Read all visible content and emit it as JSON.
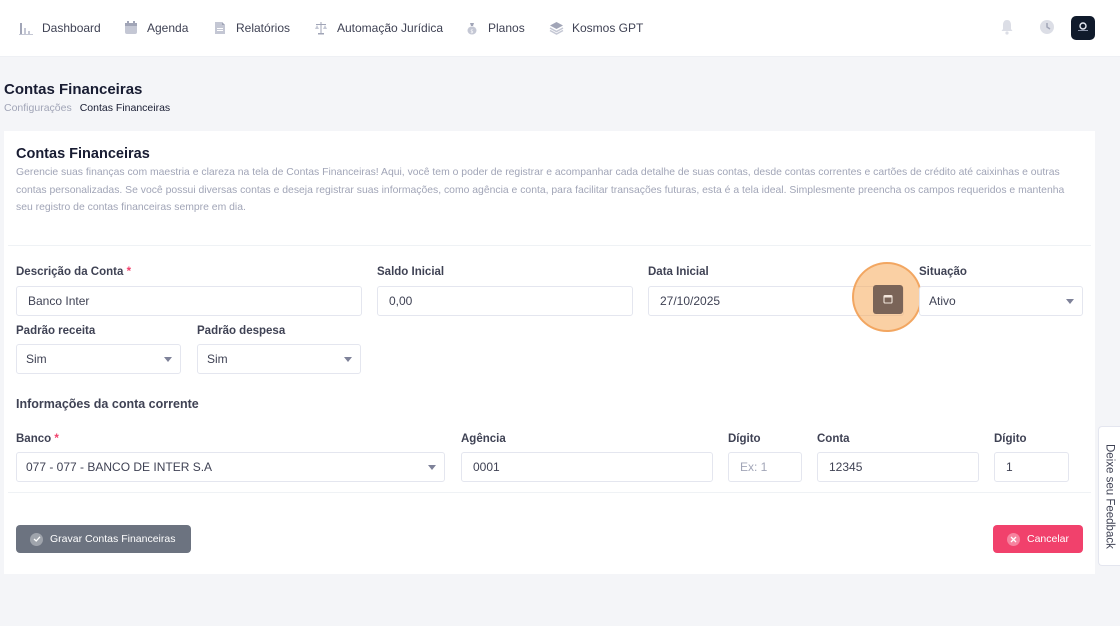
{
  "nav": {
    "items": [
      {
        "label": "Dashboard",
        "icon": "bar-chart-icon"
      },
      {
        "label": "Agenda",
        "icon": "calendar-icon"
      },
      {
        "label": "Relatórios",
        "icon": "document-icon"
      },
      {
        "label": "Automação Jurídica",
        "icon": "scale-icon"
      },
      {
        "label": "Planos",
        "icon": "money-bag-icon"
      },
      {
        "label": "Kosmos GPT",
        "icon": "layers-icon"
      }
    ],
    "right_icons": [
      "bell-icon",
      "clock-icon"
    ]
  },
  "page": {
    "title": "Contas Financeiras",
    "breadcrumb": [
      "Configurações",
      "Contas Financeiras"
    ]
  },
  "card": {
    "title": "Contas Financeiras",
    "description": "Gerencie suas finanças com maestria e clareza na tela de Contas Financeiras! Aqui, você tem o poder de registrar e acompanhar cada detalhe de suas contas, desde contas correntes e cartões de crédito até caixinhas e outras contas personalizadas. Se você possui diversas contas e deseja registrar suas informações, como agência e conta, para facilitar transações futuras, esta é a tela ideal. Simplesmente preencha os campos requeridos e mantenha seu registro de contas financeiras sempre em dia."
  },
  "form": {
    "descricao": {
      "label": "Descrição da Conta",
      "required_mark": "*",
      "value": "Banco Inter"
    },
    "saldo": {
      "label": "Saldo Inicial",
      "value": "0,00"
    },
    "data": {
      "label": "Data Inicial",
      "value": "27/10/2025"
    },
    "situacao": {
      "label": "Situação",
      "value": "Ativo"
    },
    "padrao_receita": {
      "label": "Padrão receita",
      "value": "Sim"
    },
    "padrao_despesa": {
      "label": "Padrão despesa",
      "value": "Sim"
    },
    "conta_corrente_title": "Informações da conta corrente",
    "banco": {
      "label": "Banco",
      "required_mark": "*",
      "value": "077 - 077 - BANCO DE INTER S.A"
    },
    "agencia": {
      "label": "Agência",
      "value": "0001"
    },
    "digito_agencia": {
      "label": "Dígito",
      "placeholder": "Ex: 1",
      "value": ""
    },
    "conta": {
      "label": "Conta",
      "value": "12345"
    },
    "digito_conta": {
      "label": "Dígito",
      "value": "1"
    }
  },
  "actions": {
    "save_label": "Gravar Contas Financeiras",
    "cancel_label": "Cancelar"
  },
  "feedback": {
    "label": "Deixe seu Feedback"
  },
  "colors": {
    "primary_gray": "#6c7380",
    "danger": "#f1416c",
    "highlight": "#f6aa5a",
    "avatar_bg": "#101a2b"
  }
}
